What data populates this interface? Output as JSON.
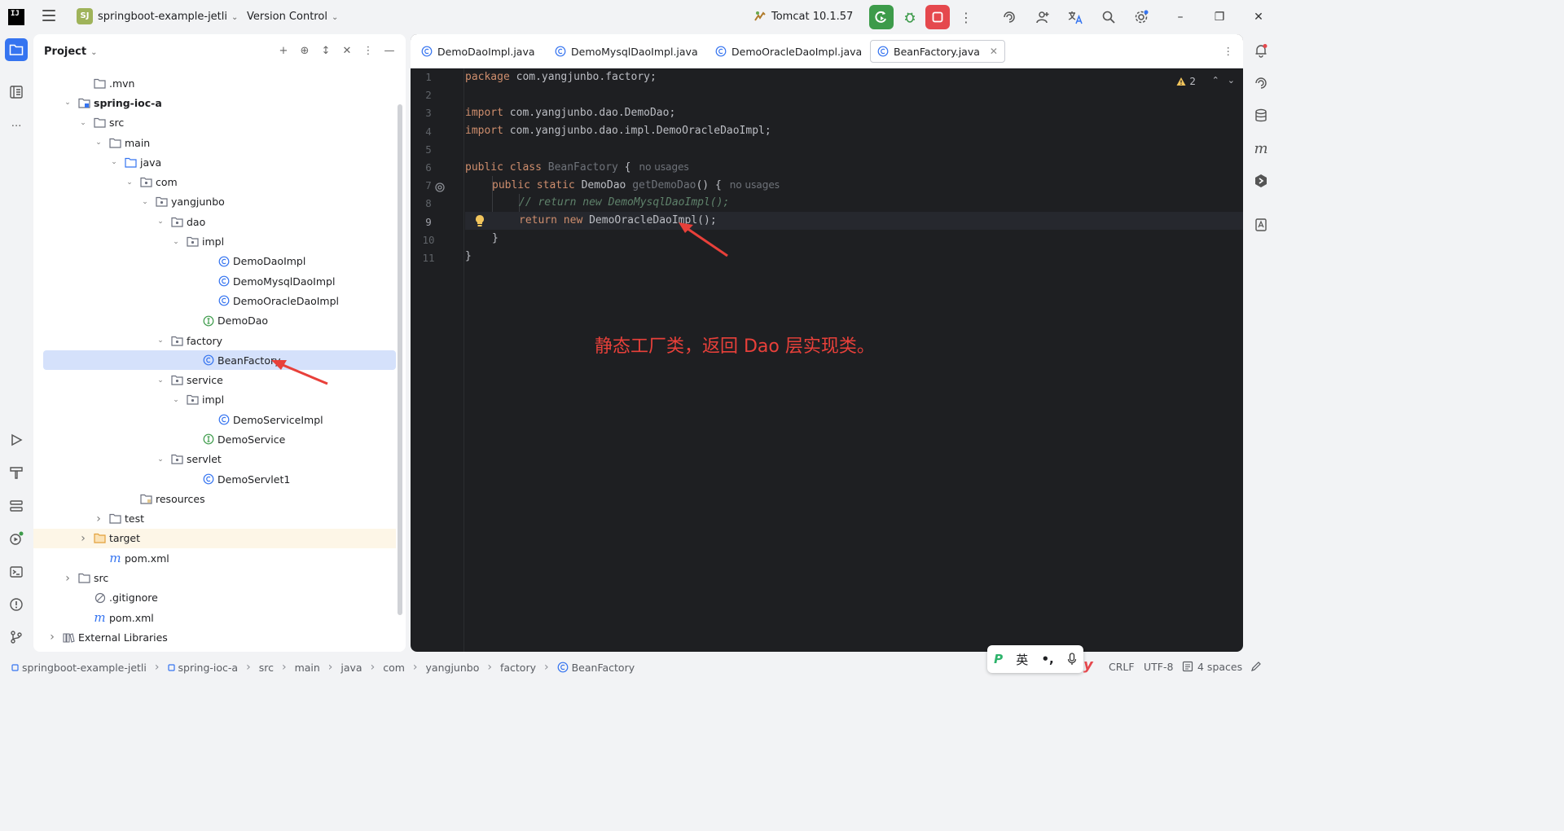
{
  "titlebar": {
    "logo_text": "IJ",
    "project_badge": "SJ",
    "project_name": "springboot-example-jetli",
    "vcs_label": "Version Control",
    "run_config": "Tomcat 10.1.57",
    "colors": {
      "run_green": "#3d9b4a",
      "stop_red": "#e5484d",
      "accent": "#3574f0"
    }
  },
  "project_panel": {
    "title": "Project",
    "tree": [
      {
        "label": ".mvn",
        "icon": "folder-icon",
        "arrow": "",
        "level": 2
      },
      {
        "label": "spring-ioc-a",
        "icon": "module-icon",
        "arrow": "expanded",
        "level": 1,
        "bold": true
      },
      {
        "label": "src",
        "icon": "folder-icon",
        "arrow": "expanded",
        "level": 2
      },
      {
        "label": "main",
        "icon": "folder-icon",
        "arrow": "expanded",
        "level": 3
      },
      {
        "label": "java",
        "icon": "source-folder-icon",
        "arrow": "expanded",
        "level": 4
      },
      {
        "label": "com",
        "icon": "package-icon",
        "arrow": "expanded",
        "level": 5
      },
      {
        "label": "yangjunbo",
        "icon": "package-icon",
        "arrow": "expanded",
        "level": 6
      },
      {
        "label": "dao",
        "icon": "package-icon",
        "arrow": "expanded",
        "level": 7
      },
      {
        "label": "impl",
        "icon": "package-icon",
        "arrow": "expanded",
        "level": 8
      },
      {
        "label": "DemoDaoImpl",
        "icon": "class-icon",
        "arrow": "",
        "level": 10
      },
      {
        "label": "DemoMysqlDaoImpl",
        "icon": "class-icon",
        "arrow": "",
        "level": 10
      },
      {
        "label": "DemoOracleDaoImpl",
        "icon": "class-icon",
        "arrow": "",
        "level": 10
      },
      {
        "label": "DemoDao",
        "icon": "interface-icon",
        "arrow": "",
        "level": 9
      },
      {
        "label": "factory",
        "icon": "package-icon",
        "arrow": "expanded",
        "level": 7
      },
      {
        "label": "BeanFactory",
        "icon": "class-icon",
        "arrow": "",
        "level": 9,
        "selected": true
      },
      {
        "label": "service",
        "icon": "package-icon",
        "arrow": "expanded",
        "level": 7
      },
      {
        "label": "impl",
        "icon": "package-icon",
        "arrow": "expanded",
        "level": 8
      },
      {
        "label": "DemoServiceImpl",
        "icon": "class-icon",
        "arrow": "",
        "level": 10
      },
      {
        "label": "DemoService",
        "icon": "interface-icon",
        "arrow": "",
        "level": 9
      },
      {
        "label": "servlet",
        "icon": "package-icon",
        "arrow": "expanded",
        "level": 7
      },
      {
        "label": "DemoServlet1",
        "icon": "class-icon",
        "arrow": "",
        "level": 9
      },
      {
        "label": "resources",
        "icon": "resources-folder-icon",
        "arrow": "",
        "level": 5
      },
      {
        "label": "test",
        "icon": "folder-icon",
        "arrow": "collapsed",
        "level": 3
      },
      {
        "label": "target",
        "icon": "excluded-folder-icon",
        "arrow": "collapsed",
        "level": 2,
        "highlighted": true
      },
      {
        "label": "pom.xml",
        "icon": "maven-icon",
        "arrow": "",
        "level": 3
      },
      {
        "label": "src",
        "icon": "folder-icon",
        "arrow": "collapsed",
        "level": 1
      },
      {
        "label": ".gitignore",
        "icon": "ignore-file-icon",
        "arrow": "",
        "level": 2
      },
      {
        "label": "pom.xml",
        "icon": "maven-icon",
        "arrow": "",
        "level": 2
      },
      {
        "label": "External Libraries",
        "icon": "library-icon",
        "arrow": "collapsed",
        "level": 0
      }
    ]
  },
  "editor": {
    "tabs": [
      {
        "label": "DemoDaoImpl.java",
        "active": false
      },
      {
        "label": "DemoMysqlDaoImpl.java",
        "active": false
      },
      {
        "label": "DemoOracleDaoImpl.java",
        "active": false
      },
      {
        "label": "BeanFactory.java",
        "active": true
      }
    ],
    "warning_count": "2",
    "line_numbers": [
      "1",
      "2",
      "3",
      "4",
      "5",
      "6",
      "7",
      "8",
      "9",
      "10",
      "11"
    ],
    "current_line": 9,
    "lines": {
      "l1_kw": "package",
      "l1_rest": " com.yangjunbo.factory;",
      "l3_kw": "import",
      "l3_rest": " com.yangjunbo.dao.DemoDao;",
      "l4_kw": "import",
      "l4_rest": " com.yangjunbo.dao.impl.DemoOracleDaoImpl;",
      "l6_kw": "public class",
      "l6_name": "BeanFactory",
      "l6_rest": " {",
      "l6_hint": "no usages",
      "l7_kw": "public static",
      "l7_type": "DemoDao",
      "l7_fn": "getDemoDao",
      "l7_rest": "() {",
      "l7_hint": "no usages",
      "l8_comment": "// return new DemoMysqlDaoImpl();",
      "l9_kw": "return new",
      "l9_rest": " DemoOracleDaoImpl();",
      "l10": "}",
      "l11": "}"
    },
    "annotation": "静态工厂类，返回 Dao 层实现类。",
    "annotation_color": "#e8403a"
  },
  "statusbar": {
    "breadcrumbs": [
      "springboot-example-jetli",
      "spring-ioc-a",
      "src",
      "main",
      "java",
      "com",
      "yangjunbo",
      "factory",
      "BeanFactory"
    ],
    "line_separator": "CRLF",
    "encoding": "UTF-8",
    "indent": "4 spaces"
  },
  "ime": {
    "lang": "英",
    "punct": "•,"
  }
}
